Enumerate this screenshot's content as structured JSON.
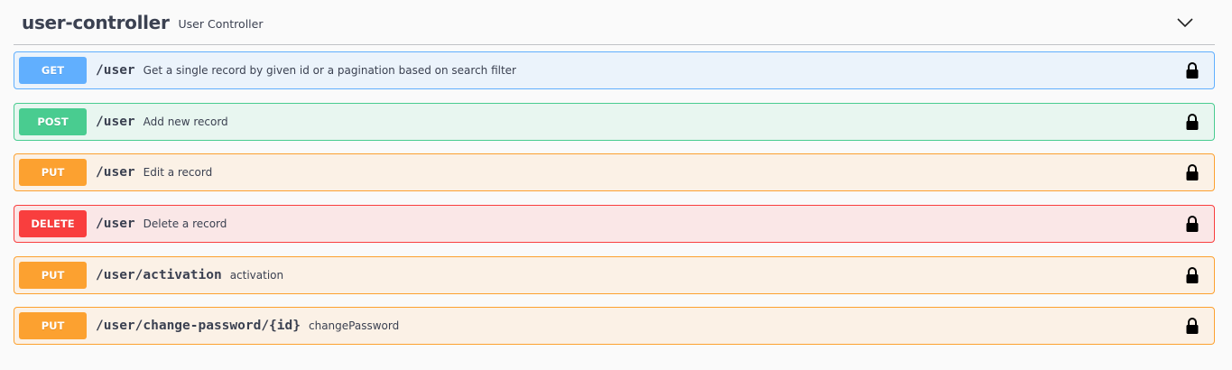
{
  "tag": {
    "name": "user-controller",
    "description": "User Controller"
  },
  "operations": [
    {
      "method": "GET",
      "path": "/user",
      "summary": "Get a single record by given id or a pagination based on search filter"
    },
    {
      "method": "POST",
      "path": "/user",
      "summary": "Add new record"
    },
    {
      "method": "PUT",
      "path": "/user",
      "summary": "Edit a record"
    },
    {
      "method": "DELETE",
      "path": "/user",
      "summary": "Delete a record"
    },
    {
      "method": "PUT",
      "path": "/user/activation",
      "summary": "activation"
    },
    {
      "method": "PUT",
      "path": "/user/change-password/{id}",
      "summary": "changePassword"
    }
  ],
  "icons": {
    "collapse": "chevron-down-icon",
    "auth": "lock-icon"
  },
  "colors": {
    "get": "#61affe",
    "post": "#49cc90",
    "put": "#fca130",
    "delete": "#f93e3e",
    "text": "#3b4151"
  }
}
